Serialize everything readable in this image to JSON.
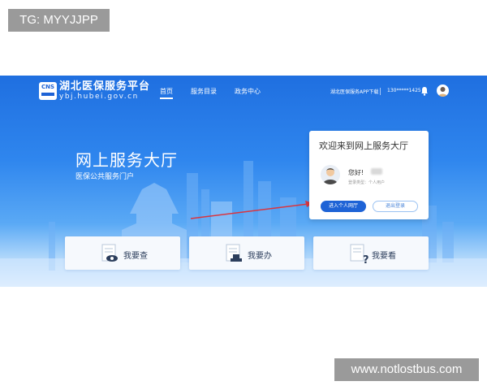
{
  "watermarks": {
    "top": "TG: MYYJJPP",
    "bottom": "www.notlostbus.com"
  },
  "header": {
    "logo_text": "CNS",
    "title": "湖北医保服务平台",
    "domain": "ybj.hubei.gov.cn",
    "nav": [
      {
        "label": "首页",
        "active": true
      },
      {
        "label": "服务目录",
        "active": false
      },
      {
        "label": "政务中心",
        "active": false
      }
    ],
    "app_download": "湖北医保服务APP下载",
    "phone": "130*****1425"
  },
  "hero": {
    "title": "网上服务大厅",
    "subtitle": "医保公共服务门户"
  },
  "welcome_card": {
    "title": "欢迎来到网上服务大厅",
    "greeting": "您好!",
    "login_type": "登录类型：个人用户",
    "enter_button": "进入个人网厅",
    "logout_button": "退出登录"
  },
  "services": [
    {
      "label": "我要查",
      "icon": "search-doc-icon"
    },
    {
      "label": "我要办",
      "icon": "stamp-doc-icon"
    },
    {
      "label": "我要看",
      "icon": "question-doc-icon"
    }
  ],
  "colors": {
    "primary": "#1e63d6",
    "sky_top": "#1f6fe0",
    "arrow": "#d9353f"
  }
}
